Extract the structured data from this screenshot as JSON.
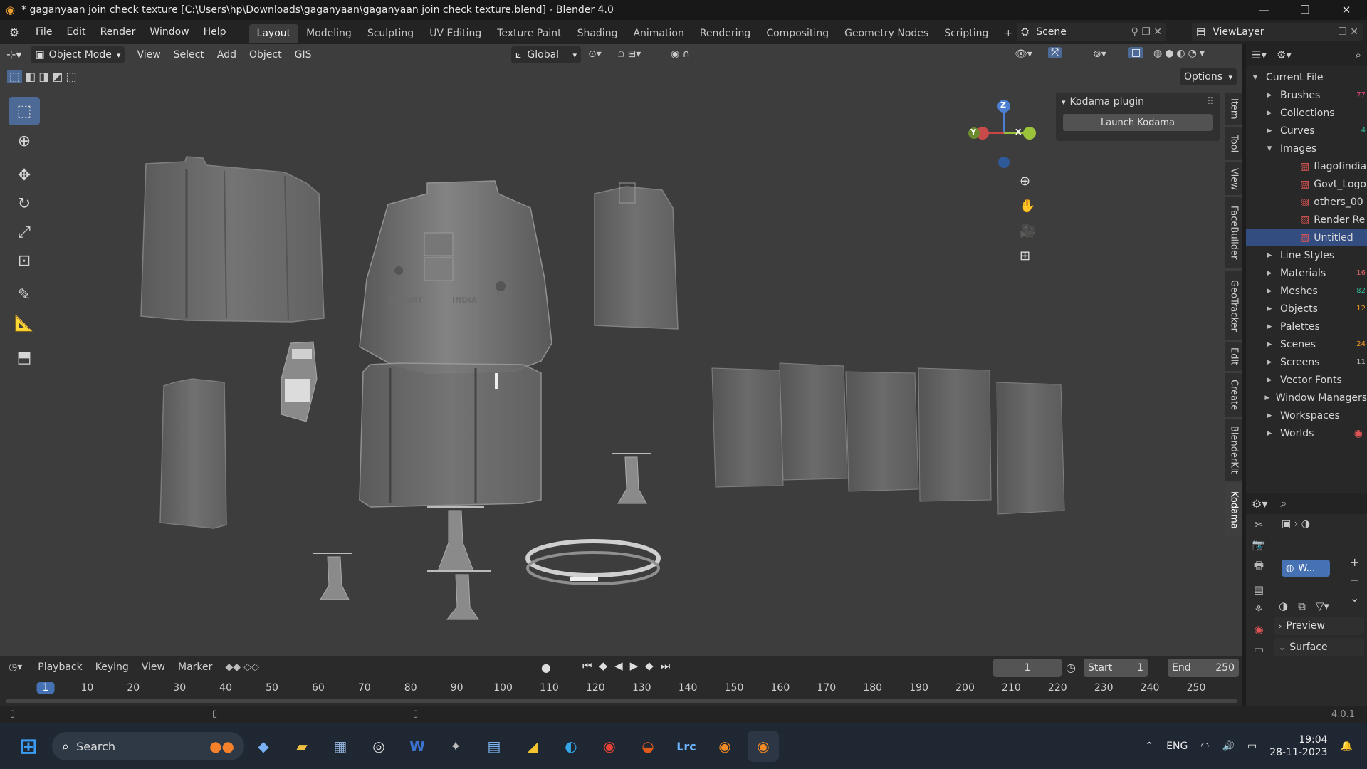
{
  "title_bar": {
    "title": "* gaganyaan join check texture [C:\\Users\\hp\\Downloads\\gaganyaan\\gaganyaan join check texture.blend] - Blender 4.0",
    "minimize": "—",
    "maximize": "❐",
    "close": "✕"
  },
  "menu": [
    "File",
    "Edit",
    "Render",
    "Window",
    "Help"
  ],
  "workspaces": [
    "Layout",
    "Modeling",
    "Sculpting",
    "UV Editing",
    "Texture Paint",
    "Shading",
    "Animation",
    "Rendering",
    "Compositing",
    "Geometry Nodes",
    "Scripting"
  ],
  "add_workspace": "+",
  "scene": "Scene",
  "view_layer": "ViewLayer",
  "viewport_header": {
    "mode": "Object Mode",
    "menus": [
      "View",
      "Select",
      "Add",
      "Object",
      "GIS"
    ],
    "orientation": "Global",
    "options": "Options"
  },
  "plugin_panel": {
    "title": "Kodama plugin",
    "button": "Launch Kodama"
  },
  "side_tabs": [
    "Item",
    "Tool",
    "View",
    "FaceBuilder",
    "GeoTracker",
    "Edit",
    "Create",
    "BlenderKit",
    "Kodama"
  ],
  "gizmo": {
    "z": "Z",
    "y": "Y",
    "x": "X"
  },
  "capsule_text": {
    "left": "EXPORT",
    "right": "INDIA"
  },
  "outliner": {
    "root": "Current File",
    "items": [
      {
        "label": "Brushes",
        "badge": "77",
        "expanded": false
      },
      {
        "label": "Collections",
        "badge": "",
        "expanded": false
      },
      {
        "label": "Curves",
        "badge": "4",
        "expanded": false
      },
      {
        "label": "Images",
        "badge": "",
        "expanded": true
      }
    ],
    "images": [
      "flagofindia",
      "Govt_Logo",
      "others_00",
      "Render Re",
      "Untitled"
    ],
    "more_items": [
      {
        "label": "Line Styles",
        "badge": ""
      },
      {
        "label": "Materials",
        "badge": "16"
      },
      {
        "label": "Meshes",
        "badge": "82"
      },
      {
        "label": "Objects",
        "badge": "12"
      },
      {
        "label": "Palettes",
        "badge": ""
      },
      {
        "label": "Scenes",
        "badge": "24"
      },
      {
        "label": "Screens",
        "badge": "11"
      },
      {
        "label": "Vector Fonts",
        "badge": ""
      },
      {
        "label": "Window Managers",
        "badge": ""
      },
      {
        "label": "Workspaces",
        "badge": ""
      },
      {
        "label": "Worlds",
        "badge": ""
      }
    ]
  },
  "properties": {
    "world_slot": "W...",
    "preview": "Preview",
    "surface": "Surface",
    "version": "4.0.1"
  },
  "timeline": {
    "menus": [
      "Playback",
      "Keying",
      "View",
      "Marker"
    ],
    "current_frame": "1",
    "start_label": "Start",
    "start": "1",
    "end_label": "End",
    "end": "250",
    "ticks": [
      "1",
      "10",
      "20",
      "30",
      "40",
      "50",
      "60",
      "70",
      "80",
      "90",
      "100",
      "110",
      "120",
      "130",
      "140",
      "150",
      "160",
      "170",
      "180",
      "190",
      "200",
      "210",
      "220",
      "230",
      "240",
      "250"
    ]
  },
  "taskbar": {
    "search": "Search",
    "language": "ENG",
    "time": "19:04",
    "date": "28-11-2023",
    "lrc": "Lrc"
  }
}
